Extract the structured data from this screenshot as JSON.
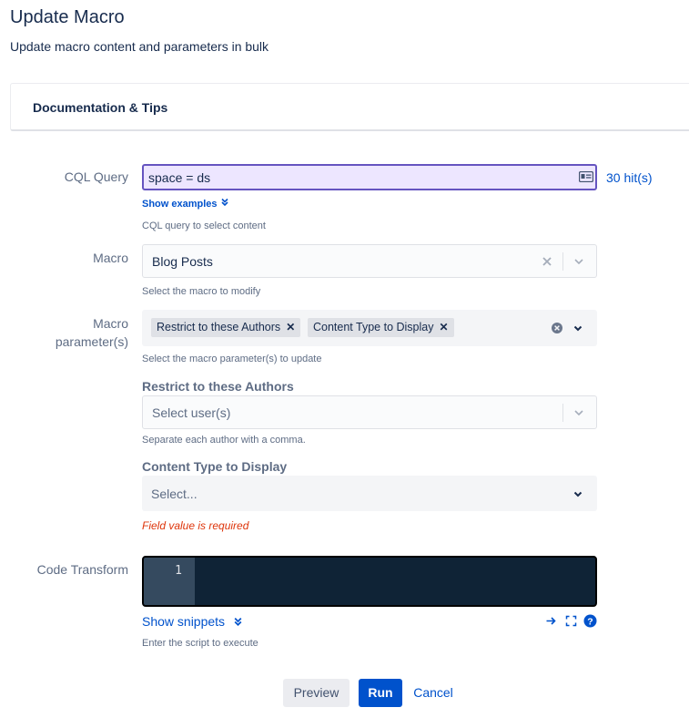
{
  "header": {
    "title": "Update Macro",
    "subtitle": "Update macro content and parameters in bulk"
  },
  "documentation_panel": {
    "label": "Documentation & Tips"
  },
  "cql": {
    "label": "CQL Query",
    "value": "space = ds",
    "hits": "30 hit(s)",
    "show_examples": "Show examples",
    "help": "CQL query to select content"
  },
  "macro": {
    "label": "Macro",
    "value": "Blog Posts",
    "help": "Select the macro to modify"
  },
  "macro_params": {
    "label_line1": "Macro",
    "label_line2": "parameter(s)",
    "tags": [
      "Restrict to these Authors",
      "Content Type to Display"
    ],
    "help": "Select the macro parameter(s) to update"
  },
  "authors": {
    "label": "Restrict to these Authors",
    "placeholder": "Select user(s)",
    "help": "Separate each author with a comma."
  },
  "content_type": {
    "label": "Content Type to Display",
    "placeholder": "Select...",
    "error": "Field value is required"
  },
  "code_transform": {
    "label": "Code Transform",
    "line_number": "1",
    "show_snippets": "Show snippets",
    "help": "Enter the script to execute"
  },
  "actions": {
    "preview": "Preview",
    "run": "Run",
    "cancel": "Cancel"
  },
  "colors": {
    "primary": "#0052cc",
    "error": "#de350b",
    "cql_bg": "#ede6ff",
    "cql_border": "#6554c0",
    "code_bg": "#0f2336"
  },
  "icons": [
    "id-card-icon",
    "chevron-double-down-icon",
    "clear-icon",
    "chevron-down-icon",
    "tag-remove-icon",
    "arrow-right-icon",
    "fullscreen-icon",
    "help-icon"
  ]
}
